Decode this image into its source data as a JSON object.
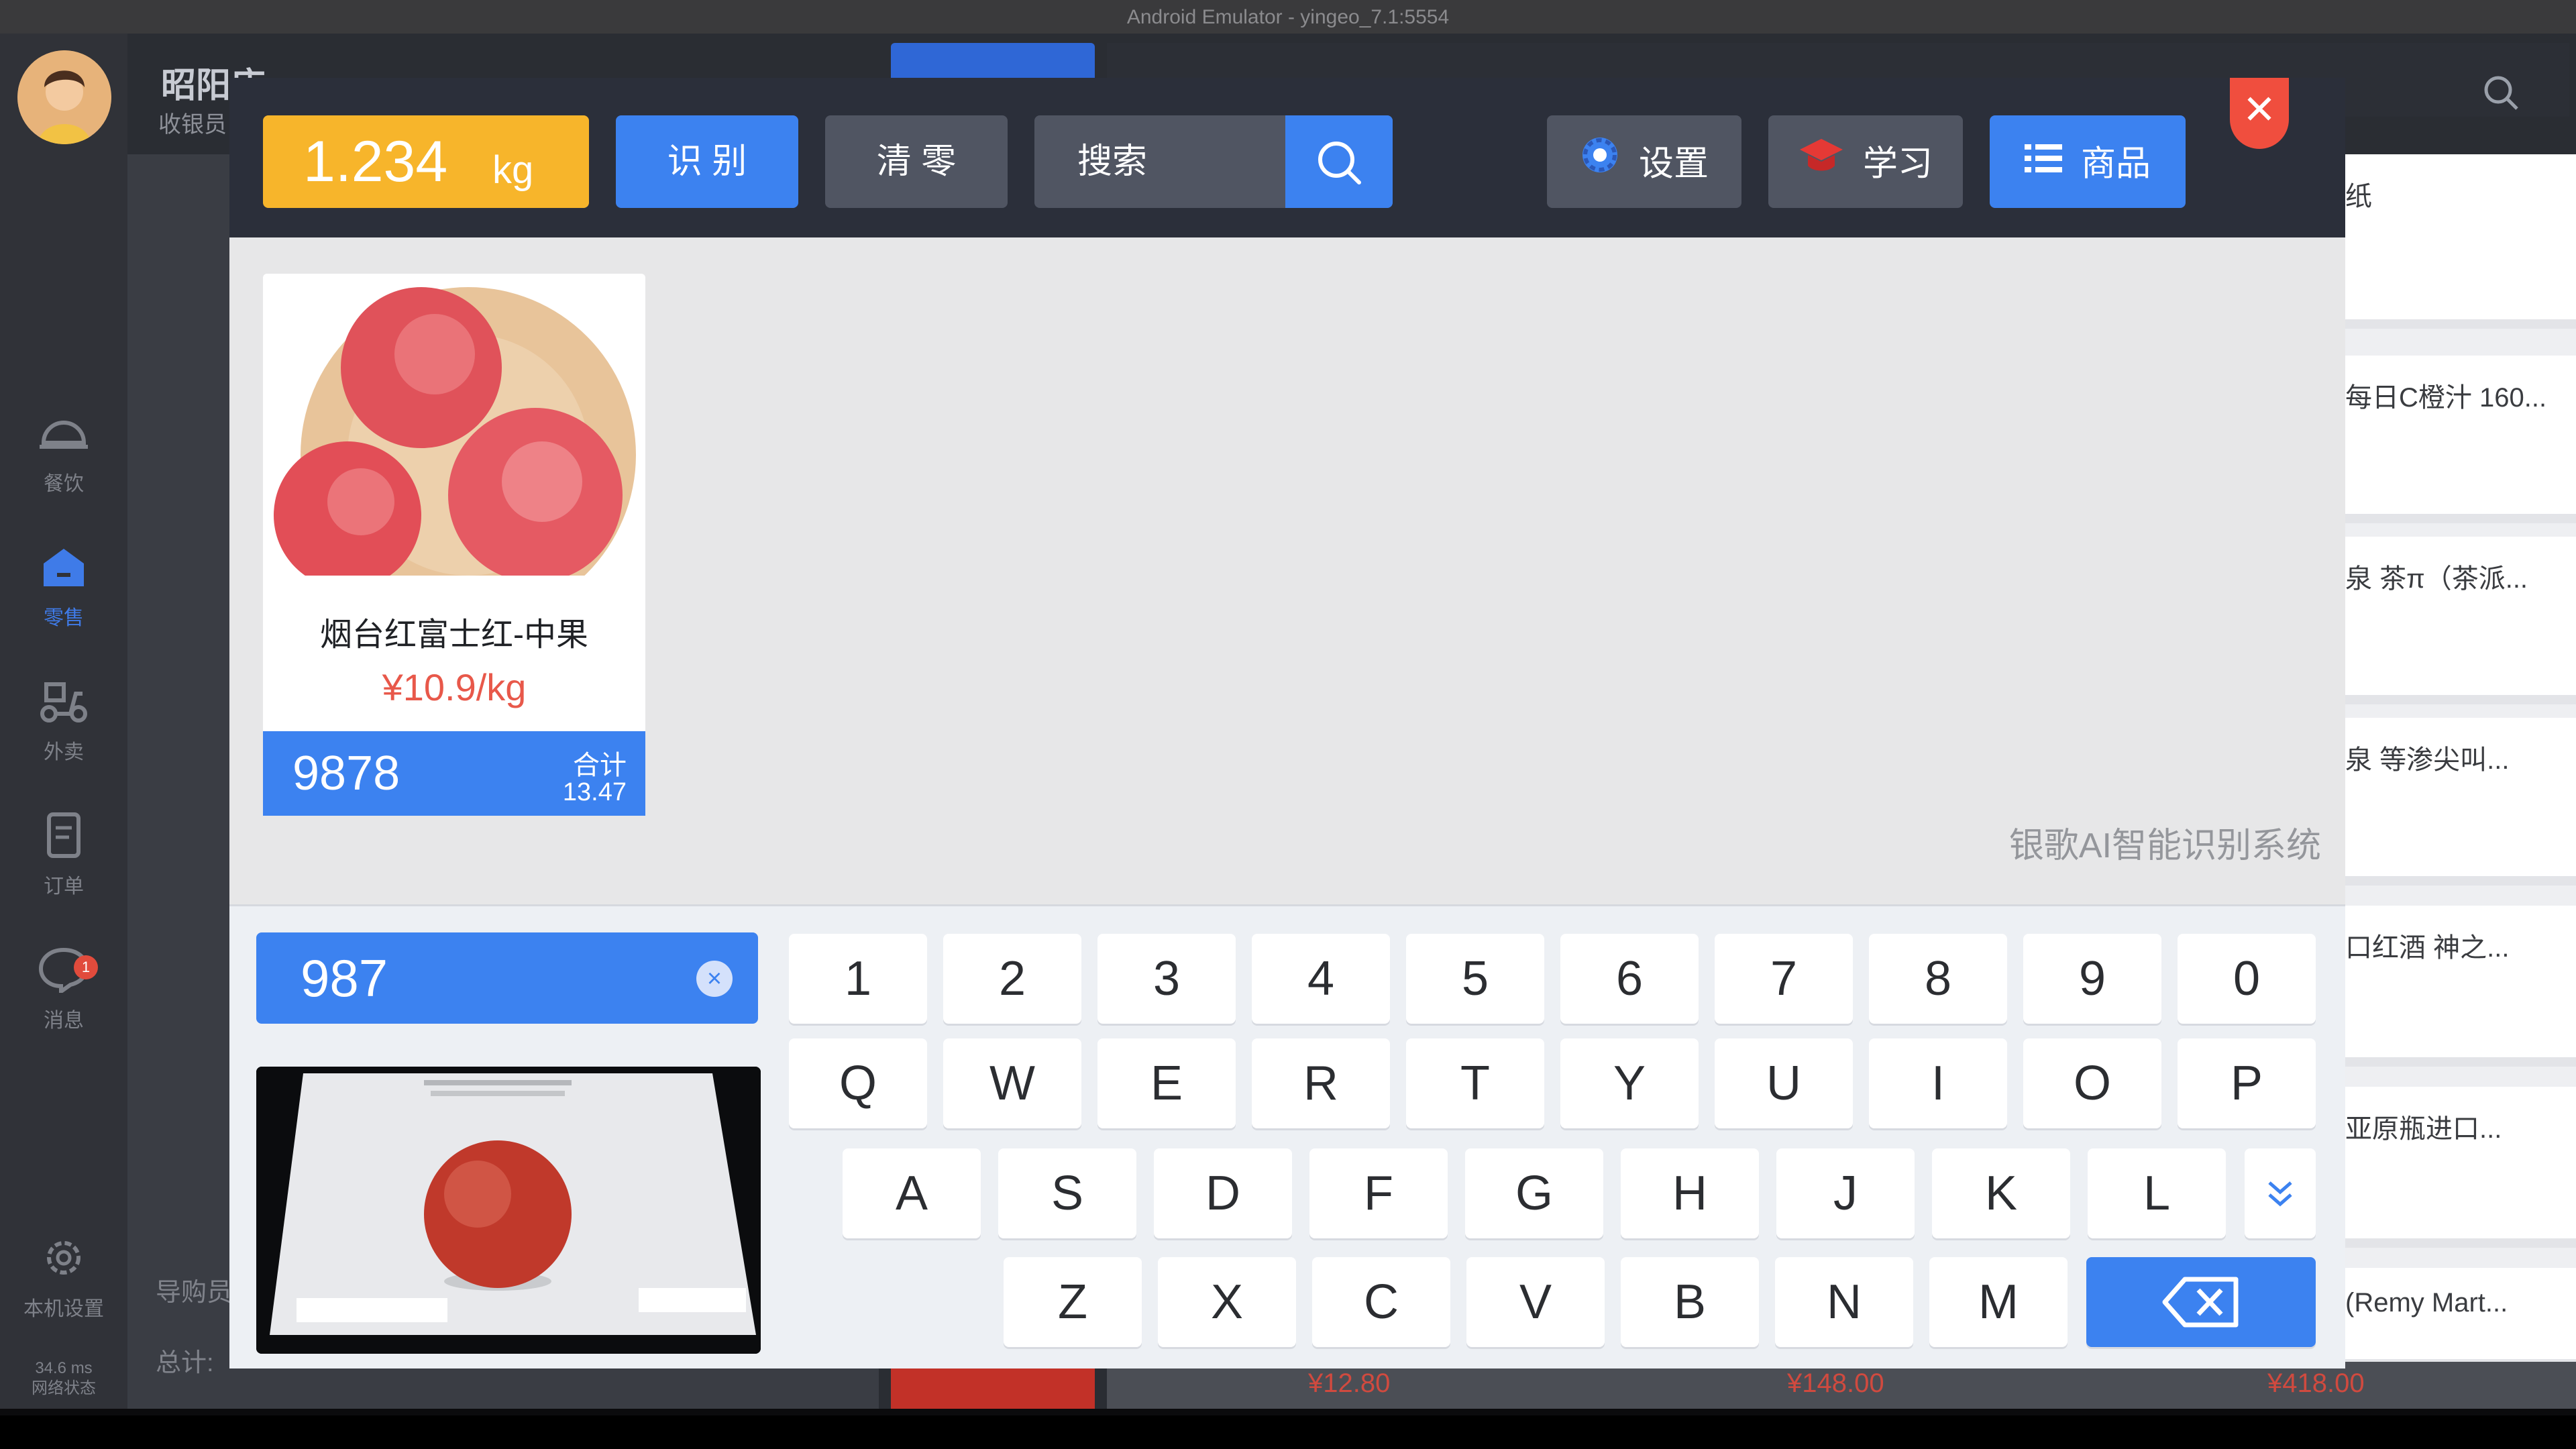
{
  "emulator": {
    "title": "Android Emulator - yingeo_7.1:5554"
  },
  "background_app": {
    "shop_name": "昭阳店",
    "cashier_label": "收银员",
    "sidebar": [
      {
        "label": "餐饮",
        "icon": "bell-cover-icon"
      },
      {
        "label": "零售",
        "icon": "shop-icon",
        "active": true
      },
      {
        "label": "外卖",
        "icon": "scooter-icon"
      },
      {
        "label": "订单",
        "icon": "order-doc-icon"
      },
      {
        "label": "消息",
        "icon": "chat-icon",
        "badge": "1"
      }
    ],
    "settings_label": "本机设置",
    "latency": "34.6 ms",
    "network_label": "网络状态",
    "guide_label": "导购员",
    "total_label": "总计:",
    "right_items": [
      "纸",
      "每日C橙汁 160...",
      "泉 茶π（茶派...",
      "泉 等渗尖叫...",
      "口红酒 神之...",
      "亚原瓶进口...",
      "(Remy Mart..."
    ],
    "bottom_prices": [
      "¥12.80",
      "¥148.00",
      "¥418.00"
    ]
  },
  "dialog": {
    "weight": {
      "value": "1.234",
      "unit": "kg"
    },
    "recognize_label": "识 别",
    "clear_label": "清 零",
    "search_placeholder": "搜索",
    "settings_label": "设置",
    "learn_label": "学习",
    "products_label": "商品",
    "close_symbol": "✕",
    "product": {
      "name": "烟台红富士红-中果",
      "price": "¥10.9/kg",
      "code": "9878",
      "total_label": "合计",
      "total": "13.47"
    },
    "ai_label": "银歌AI智能识别系统",
    "input_value": "987",
    "keyboard": {
      "row1": [
        "1",
        "2",
        "3",
        "4",
        "5",
        "6",
        "7",
        "8",
        "9",
        "0"
      ],
      "row2": [
        "Q",
        "W",
        "E",
        "R",
        "T",
        "Y",
        "U",
        "I",
        "O",
        "P"
      ],
      "row3": [
        "A",
        "S",
        "D",
        "F",
        "G",
        "H",
        "J",
        "K",
        "L"
      ],
      "row4": [
        "Z",
        "X",
        "C",
        "V",
        "B",
        "N",
        "M"
      ]
    }
  },
  "colors": {
    "accent": "#3c82f0",
    "weight": "#f7b52b",
    "close": "#f04e3e",
    "price": "#e8584a"
  }
}
